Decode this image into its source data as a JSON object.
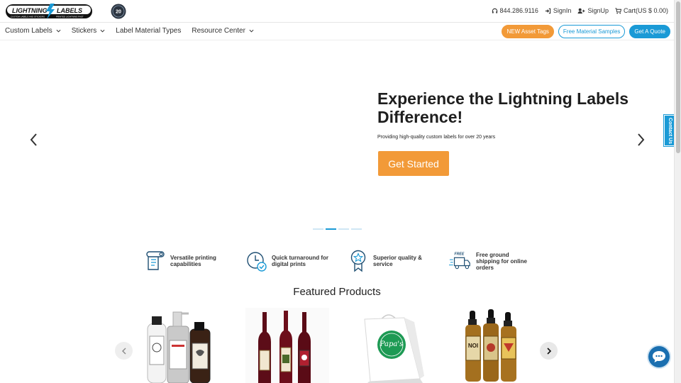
{
  "header": {
    "phone": "844.286.9116",
    "signin": "SignIn",
    "signup": "SignUp",
    "cart": "Cart(US $ 0.00)",
    "logo_main": "LIGHTNING LABELS",
    "logo_tagline_left": "CUSTOM LABELS AND STICKERS",
    "logo_tagline_right": "PRINTED LIGHTNING FAST",
    "anniversary_badge": "20"
  },
  "nav": {
    "items": [
      {
        "label": "Custom Labels",
        "dropdown": true
      },
      {
        "label": "Stickers",
        "dropdown": true
      },
      {
        "label": "Label Material Types",
        "dropdown": false
      },
      {
        "label": "Resource Center",
        "dropdown": true
      }
    ],
    "asset_tags_label": "NEW Asset Tags",
    "samples_label": "Free Material Samples",
    "quote_label": "Get A Quote"
  },
  "hero": {
    "title": "Experience the Lightning Labels Difference!",
    "subtitle": "Providing high-quality custom labels for over 20 years",
    "cta_label": "Get Started",
    "slide_count": 4,
    "active_slide": 2
  },
  "contact_tab": {
    "label": "Contact Us"
  },
  "features": [
    {
      "icon": "printer-roll-icon",
      "label": "Versatile printing capabilities"
    },
    {
      "icon": "clock-check-icon",
      "label": "Quick turnaround for digital prints"
    },
    {
      "icon": "ribbon-star-icon",
      "label": "Superior quality & service"
    },
    {
      "icon": "delivery-truck-icon",
      "label": "Free ground shipping for online orders",
      "icon_text": "FREE"
    }
  ],
  "featured": {
    "title": "Featured Products",
    "products": [
      {
        "name": "bottle-labels-product"
      },
      {
        "name": "wine-labels-product"
      },
      {
        "name": "bag-labels-product",
        "label_text": "Papa's"
      },
      {
        "name": "dropper-bottle-labels-product",
        "label_text": "NOI"
      }
    ]
  },
  "colors": {
    "brand_blue": "#1a9ad6",
    "brand_orange": "#f29a38",
    "dark_text": "#1e1e1e"
  }
}
